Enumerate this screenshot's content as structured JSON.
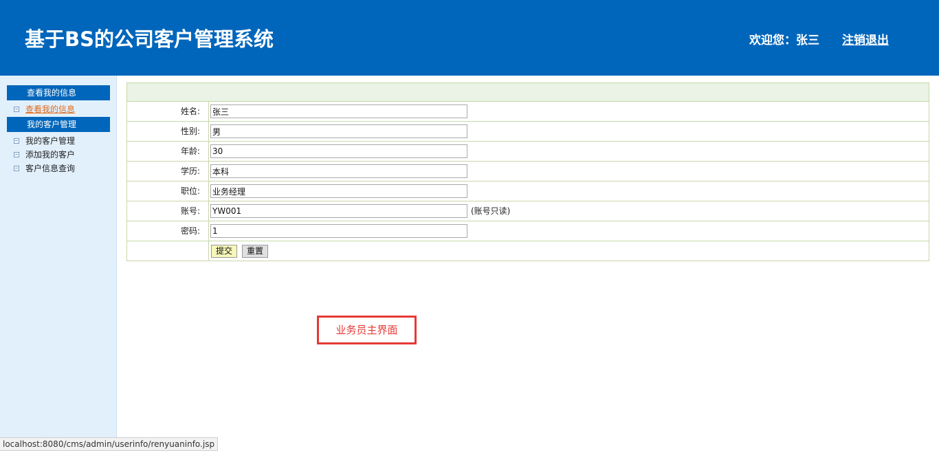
{
  "header": {
    "title": "基于BS的公司客户管理系统",
    "welcome": "欢迎您：张三",
    "logout": "注销退出"
  },
  "sidebar": {
    "section1": "查看我的信息",
    "section1_items": [
      "查看我的信息"
    ],
    "section2": "我的客户管理",
    "section2_items": [
      "我的客户管理",
      "添加我的客户",
      "客户信息查询"
    ]
  },
  "form": {
    "fields": [
      {
        "label": "姓名:",
        "value": "张三"
      },
      {
        "label": "性别:",
        "value": "男"
      },
      {
        "label": "年龄:",
        "value": "30"
      },
      {
        "label": "学历:",
        "value": "本科"
      },
      {
        "label": "职位:",
        "value": "业务经理"
      },
      {
        "label": "账号:",
        "value": "YW001",
        "note": "(账号只读)"
      },
      {
        "label": "密码:",
        "value": "1"
      }
    ],
    "submit": "提交",
    "reset": "重置"
  },
  "annotation": "业务员主界面",
  "status_url": "localhost:8080/cms/admin/userinfo/renyuaninfo.jsp",
  "colors": {
    "header_bg": "#0066bb",
    "sidebar_bg": "#e2f0fc",
    "active_link": "#e06a1b",
    "annotation_red": "#e53935"
  }
}
